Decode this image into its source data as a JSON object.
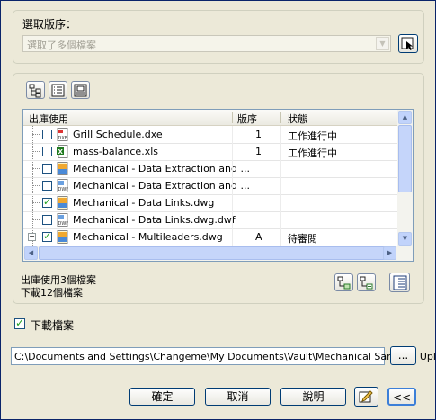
{
  "version_section": {
    "label": "選取版序：",
    "combo_value": "選取了多個檔案"
  },
  "list": {
    "columns": [
      "出庫使用",
      "版序",
      "狀態"
    ],
    "rows": [
      {
        "name": "Grill Schedule.dxe",
        "version": "1",
        "status": "工作進行中",
        "checked": false,
        "icon": "dxe-file-icon"
      },
      {
        "name": "mass-balance.xls",
        "version": "1",
        "status": "工作進行中",
        "checked": false,
        "icon": "excel-file-icon"
      },
      {
        "name": "Mechanical - Data Extraction and ...",
        "version": "",
        "status": "",
        "checked": false,
        "icon": "dwg-file-icon"
      },
      {
        "name": "Mechanical - Data Extraction and ...",
        "version": "",
        "status": "",
        "checked": false,
        "icon": "dwf-file-icon"
      },
      {
        "name": "Mechanical - Data Links.dwg",
        "version": "",
        "status": "",
        "checked": true,
        "icon": "dwg-file-icon"
      },
      {
        "name": "Mechanical - Data Links.dwg.dwf",
        "version": "",
        "status": "",
        "checked": false,
        "icon": "dwf-file-icon"
      },
      {
        "name": "Mechanical - Multileaders.dwg",
        "version": "A",
        "status": "待審閱",
        "checked": true,
        "icon": "dwg-file-icon"
      }
    ]
  },
  "summary": {
    "checkout_count": "出庫使用3個檔案",
    "download_count": "下載12個檔案"
  },
  "download": {
    "label": "下載檔案",
    "checked": true,
    "path": "C:\\Documents and Settings\\Changeme\\My Documents\\Vault\\Mechanical Samples Uplc",
    "browse_label": "..."
  },
  "buttons": {
    "ok": "確定",
    "cancel": "取消",
    "help": "說明",
    "collapse": "<<"
  },
  "colors": {
    "dialog_bg": "#ece9d8",
    "button_border": "#003c74",
    "list_border": "#7f9db9"
  }
}
